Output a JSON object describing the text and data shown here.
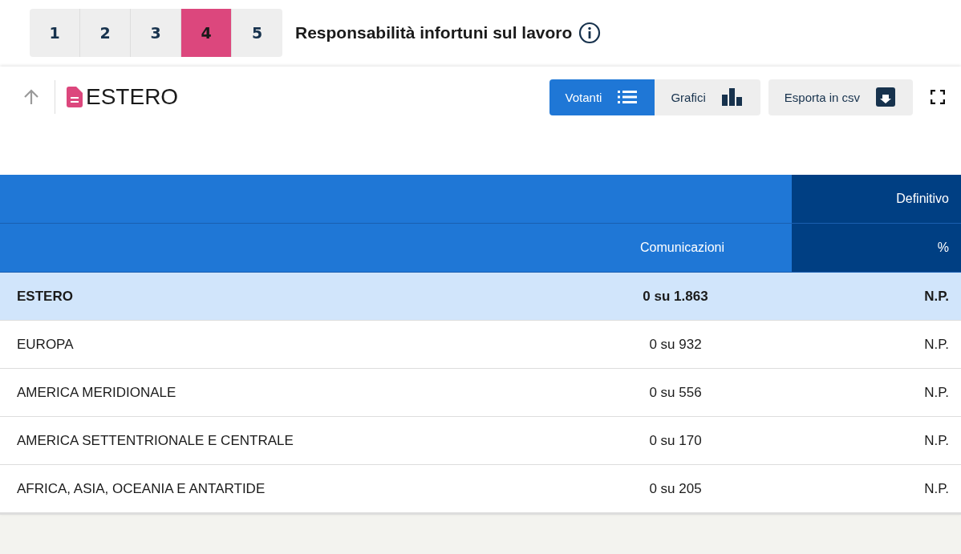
{
  "steps": [
    {
      "label": "1",
      "selected": false
    },
    {
      "label": "2",
      "selected": false
    },
    {
      "label": "3",
      "selected": false
    },
    {
      "label": "4",
      "selected": true
    },
    {
      "label": "5",
      "selected": false
    }
  ],
  "question_title": "Responsabilità infortuni sul lavoro",
  "panel": {
    "title": "ESTERO",
    "view_toggle": [
      {
        "label": "Votanti",
        "selected": true,
        "kind": "list"
      },
      {
        "label": "Grafici",
        "selected": false,
        "kind": "chart"
      }
    ],
    "export_button": "Esporta in csv",
    "table": {
      "header_group": "Definitivo",
      "columns": [
        "Comunicazioni",
        "%"
      ],
      "rows": [
        {
          "kind": "total",
          "name": "ESTERO",
          "communications": "0 su 1.863",
          "percent": "N.P."
        },
        {
          "kind": "area",
          "name": "EUROPA",
          "communications": "0 su 932",
          "percent": "N.P."
        },
        {
          "kind": "area",
          "name": "AMERICA MERIDIONALE",
          "communications": "0 su 556",
          "percent": "N.P."
        },
        {
          "kind": "area",
          "name": "AMERICA SETTENTRIONALE E CENTRALE",
          "communications": "0 su 170",
          "percent": "N.P."
        },
        {
          "kind": "area",
          "name": "AFRICA, ASIA, OCEANIA E ANTARTIDE",
          "communications": "0 su 205",
          "percent": "N.P."
        }
      ]
    }
  }
}
